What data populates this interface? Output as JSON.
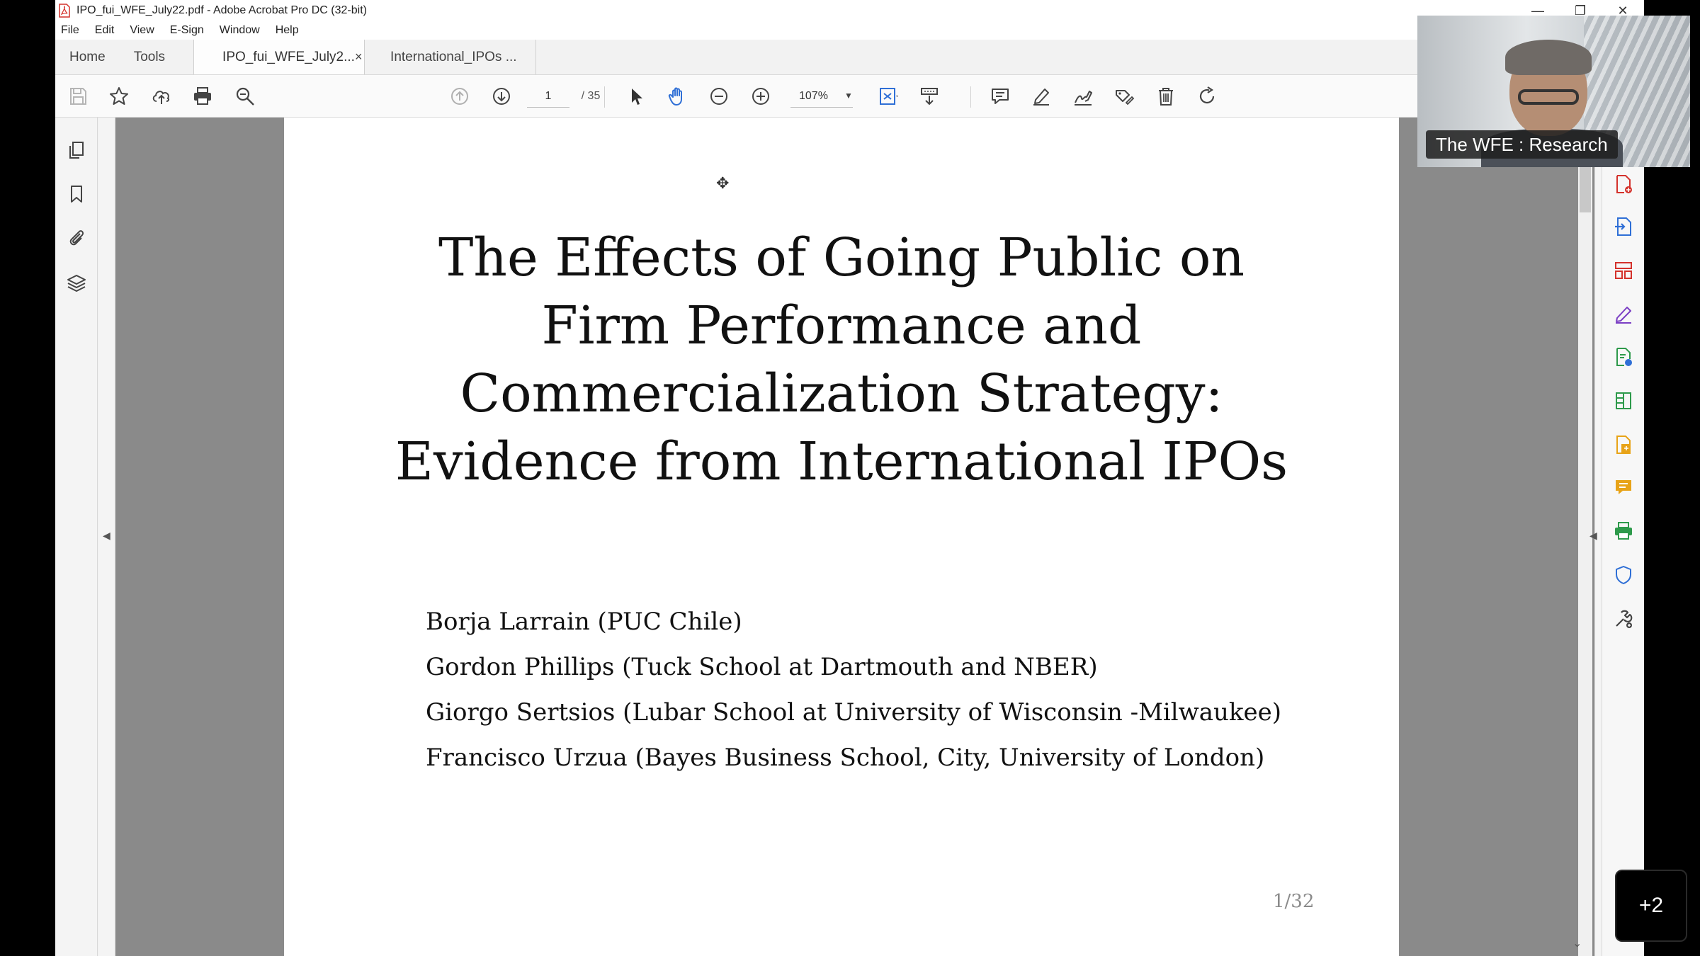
{
  "window": {
    "title": "IPO_fui_WFE_July22.pdf - Adobe Acrobat Pro DC (32-bit)",
    "minimize": "—",
    "restore": "❐",
    "close": "✕"
  },
  "menu": [
    "File",
    "Edit",
    "View",
    "E-Sign",
    "Window",
    "Help"
  ],
  "tabs": {
    "home": "Home",
    "tools": "Tools",
    "doc1": "IPO_fui_WFE_July2...",
    "doc1_close": "×",
    "doc2": "International_IPOs ..."
  },
  "toolbar": {
    "page_current": "1",
    "page_total": "/ 35",
    "zoom": "107%",
    "icons": [
      "save-icon",
      "star-icon",
      "upload-icon",
      "print-icon",
      "search-icon",
      "prev-page-icon",
      "next-page-icon",
      "select-cursor-icon",
      "hand-icon",
      "zoom-out-icon",
      "zoom-in-icon",
      "fit-page-icon",
      "scroll-mode-icon",
      "comment-icon",
      "highlight-icon",
      "sign-icon",
      "edit-icon",
      "delete-icon",
      "rotate-icon"
    ]
  },
  "left_rail": [
    "pages-icon",
    "bookmark-icon",
    "attachment-icon",
    "layers-icon"
  ],
  "right_rail": [
    "create-pdf-icon",
    "export-pdf-icon",
    "organize-pages-icon",
    "fill-sign-icon",
    "edit-pdf-icon",
    "compress-icon",
    "combine-icon",
    "comment-icon",
    "print-production-icon",
    "protect-icon",
    "more-tools-icon"
  ],
  "slide": {
    "title_lines": [
      "The Effects of Going Public on",
      "Firm Performance and",
      "Commercialization Strategy:",
      "Evidence from International IPOs"
    ],
    "authors": [
      "Borja Larrain (PUC Chile)",
      "Gordon Phillips (Tuck School at Dartmouth and NBER)",
      "Giorgo Sertsios (Lubar School at University of Wisconsin -Milwaukee)",
      "Francisco Urzua (Bayes Business School, City, University of London)"
    ],
    "page_label": "1/32"
  },
  "video": {
    "participant_label": "The WFE : Research"
  },
  "participants_more": "+2",
  "colors": {
    "acrobat_red": "#d4322c",
    "tool_blue": "#2f6fd6",
    "tool_purple": "#7b3fc4",
    "tool_green": "#2e9a4b",
    "tool_yellow": "#e8a317",
    "tool_gold": "#d8a300"
  }
}
